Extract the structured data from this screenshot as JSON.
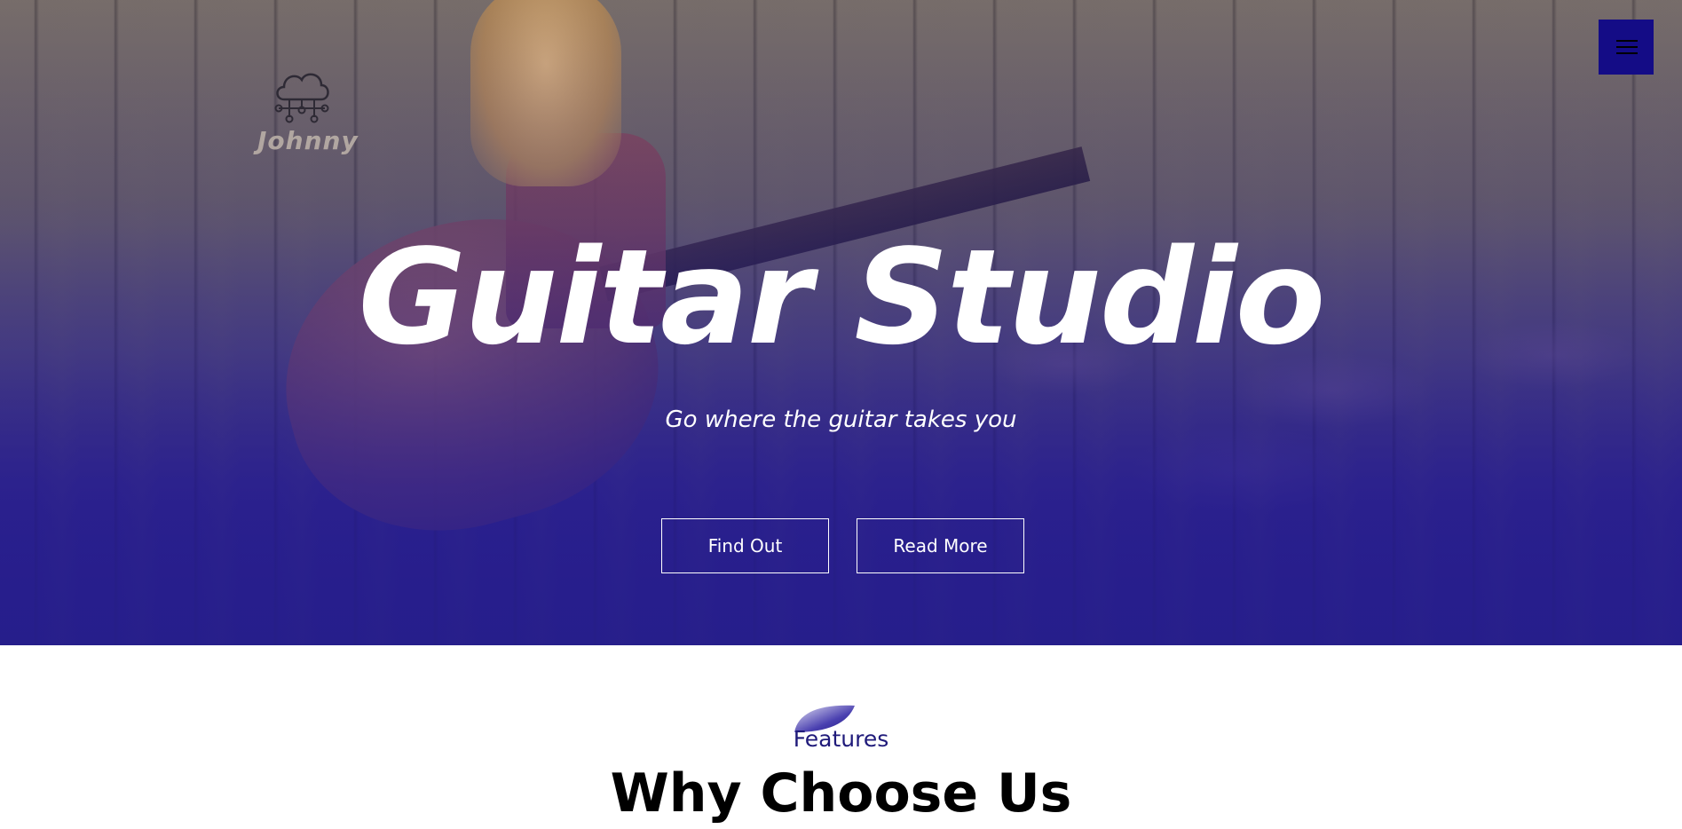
{
  "header": {
    "logo_text": "Johnny",
    "menu_icon": "hamburger-icon",
    "logo_icon": "cloud-network-icon"
  },
  "hero": {
    "title": "Guitar Studio",
    "subtitle": "Go where the guitar takes you",
    "buttons": {
      "find_out": "Find Out",
      "read_more": "Read More"
    }
  },
  "features": {
    "label": "Features",
    "title": "Why Choose Us"
  },
  "colors": {
    "accent": "#140c86",
    "hero_overlay": "#2a2380",
    "features_label": "#1f1a7a"
  }
}
